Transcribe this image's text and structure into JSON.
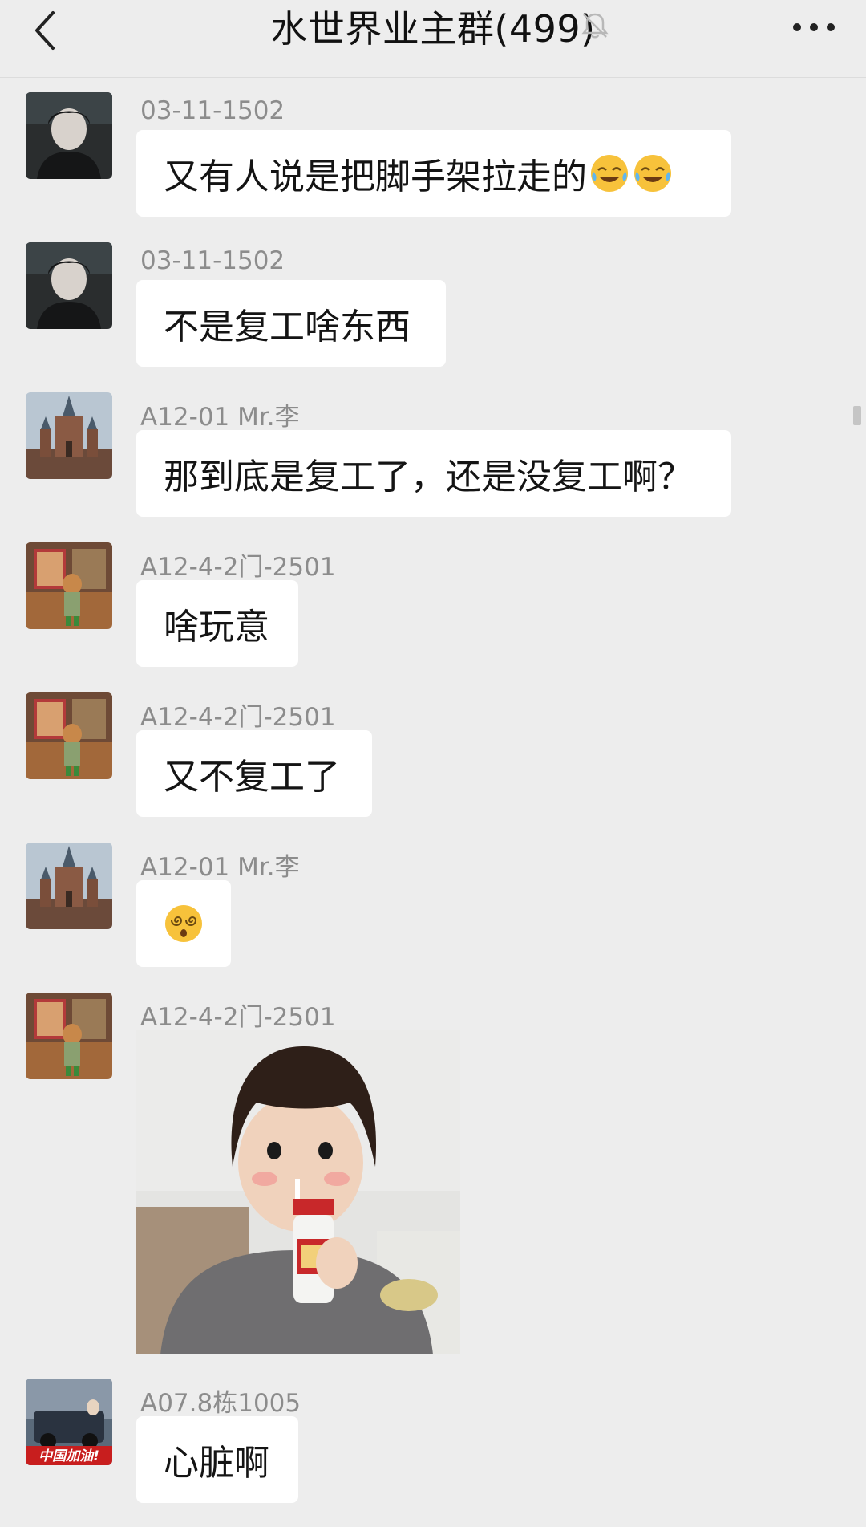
{
  "header": {
    "title": "水世界业主群(499)",
    "back_icon": "chevron-left-icon",
    "mute_icon": "bell-off-icon",
    "more_icon": "more-dots-icon"
  },
  "messages": [
    {
      "sender": "03-11-1502",
      "text": "又有人说是把脚手架拉走的",
      "emojis": [
        "laugh-cry-emoji",
        "laugh-cry-emoji"
      ]
    },
    {
      "sender": "03-11-1502",
      "text": "不是复工啥东西"
    },
    {
      "sender": "A12-01 Mr.李",
      "text": "那到底是复工了，还是没复工啊？"
    },
    {
      "sender": "A12-4-2门-2501",
      "text": "啥玩意"
    },
    {
      "sender": "A12-4-2门-2501",
      "text": "又不复工了"
    },
    {
      "sender": "A12-01 Mr.李",
      "text": "",
      "emojis": [
        "dizzy-face-emoji"
      ]
    },
    {
      "sender": "A12-4-2门-2501",
      "type": "image",
      "image_desc": "sticker-girl-with-bottle"
    },
    {
      "sender": "A07.8栋1005",
      "text": "心脏啊",
      "avatar_text": "中国加油!"
    }
  ],
  "colors": {
    "background": "#ededed",
    "bubble": "#ffffff",
    "sender_text": "#8c8c8c",
    "message_text": "#141414"
  }
}
